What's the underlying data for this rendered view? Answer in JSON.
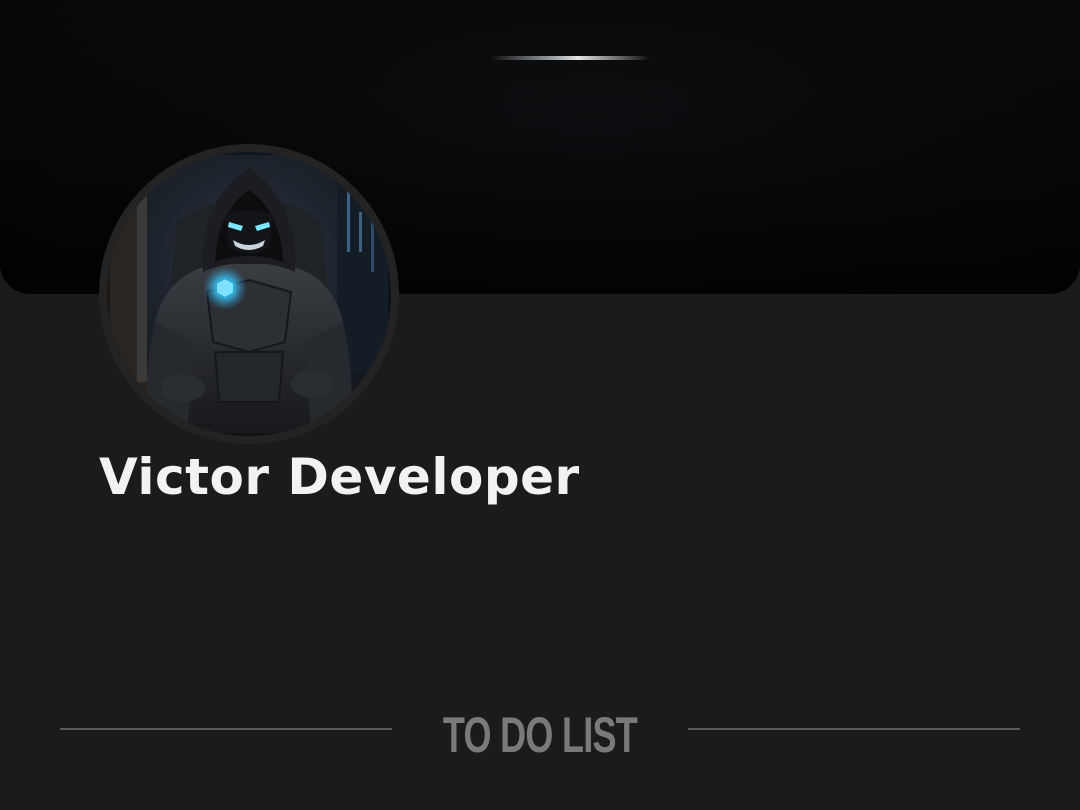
{
  "profile": {
    "name": "Victor Developer"
  },
  "section": {
    "title": "TO DO LIST"
  },
  "colors": {
    "background": "#1b1b1b",
    "cover": "#050607",
    "name_text": "#f2f2f2",
    "section_text": "#7a7a7a",
    "divider": "#5a5a5a",
    "accent_glow": "#4fd2ff"
  },
  "icons": {
    "avatar": "hooded-armored-figure-avatar"
  }
}
